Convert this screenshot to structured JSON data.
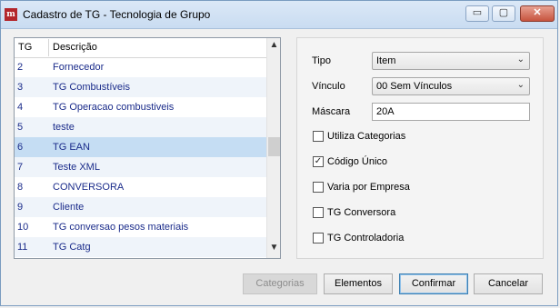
{
  "window": {
    "title": "Cadastro de TG - Tecnologia de Grupo",
    "minimize": "▭",
    "maximize": "▢",
    "close": "✕"
  },
  "list": {
    "header": {
      "col1": "TG",
      "col2": "Descrição"
    },
    "rows": [
      {
        "id": "2",
        "desc": "Fornecedor"
      },
      {
        "id": "3",
        "desc": "TG Combustíveis"
      },
      {
        "id": "4",
        "desc": "TG Operacao combustiveis"
      },
      {
        "id": "5",
        "desc": "teste"
      },
      {
        "id": "6",
        "desc": "TG EAN"
      },
      {
        "id": "7",
        "desc": "Teste XML"
      },
      {
        "id": "8",
        "desc": "CONVERSORA"
      },
      {
        "id": "9",
        "desc": "Cliente"
      },
      {
        "id": "10",
        "desc": "TG conversao pesos materiais"
      },
      {
        "id": "11",
        "desc": "TG Catg"
      }
    ],
    "selected_index": 4
  },
  "form": {
    "tipo_label": "Tipo",
    "tipo_value": "Item",
    "vinculo_label": "Vínculo",
    "vinculo_value": "00 Sem Vínculos",
    "mascara_label": "Máscara",
    "mascara_value": "20A",
    "checkboxes": [
      {
        "label": "Utiliza Categorias",
        "checked": false
      },
      {
        "label": "Código Único",
        "checked": true
      },
      {
        "label": "Varia por Empresa",
        "checked": false
      },
      {
        "label": "TG Conversora",
        "checked": false
      },
      {
        "label": "TG Controladoria",
        "checked": false
      }
    ],
    "check_mark": "✓"
  },
  "buttons": {
    "categorias": "Categorias",
    "elementos": "Elementos",
    "confirmar": "Confirmar",
    "cancelar": "Cancelar"
  }
}
